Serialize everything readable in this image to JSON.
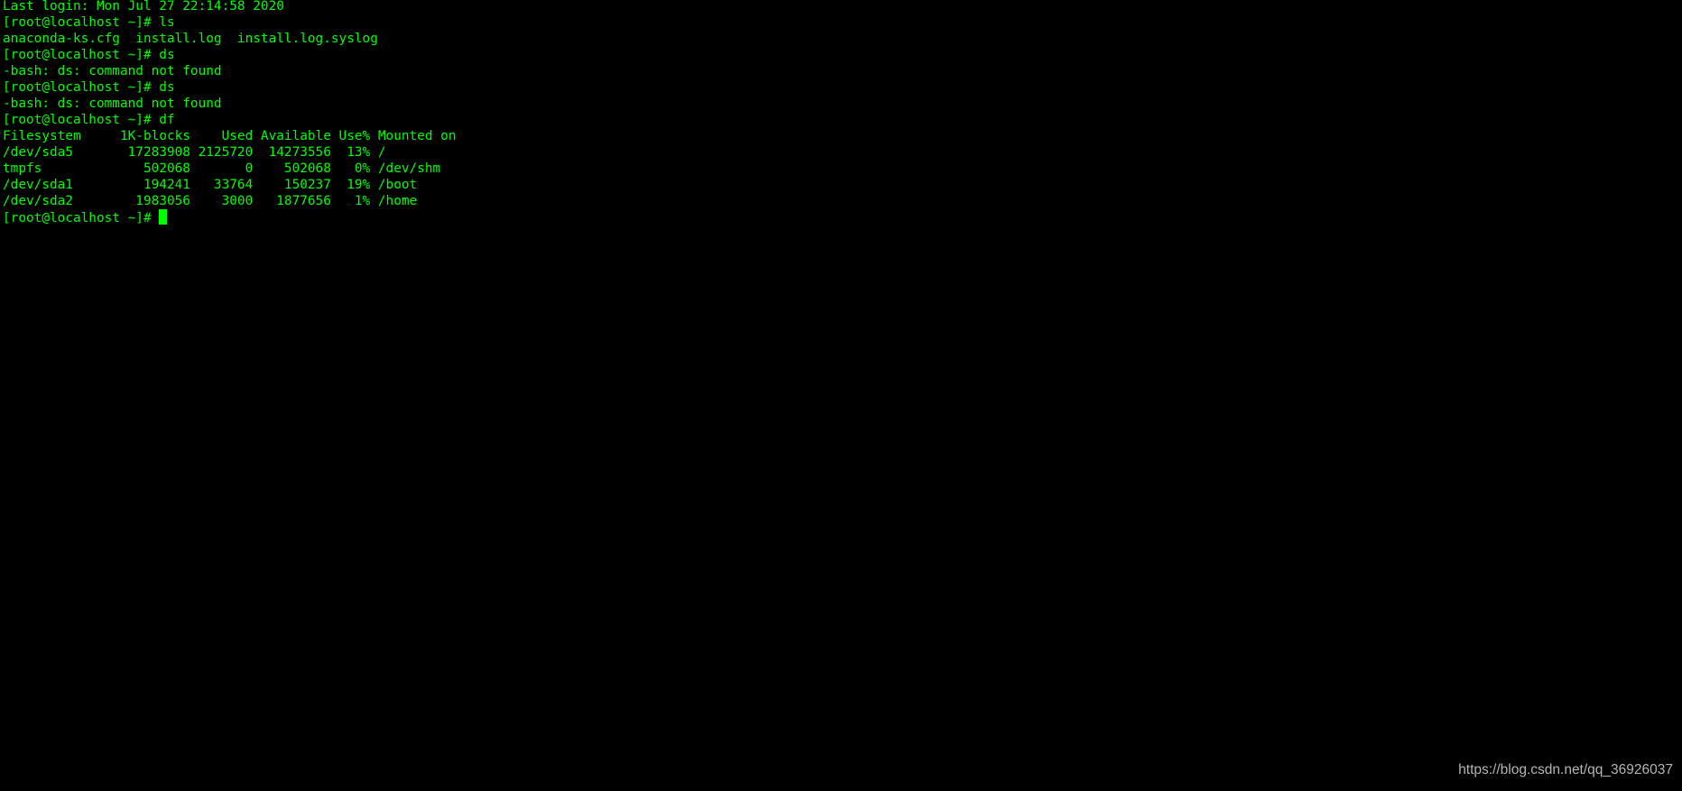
{
  "terminal": {
    "lines": [
      "Last login: Mon Jul 27 22:14:58 2020",
      "[root@localhost ~]# ls",
      "anaconda-ks.cfg  install.log  install.log.syslog",
      "[root@localhost ~]# ds",
      "-bash: ds: command not found",
      "[root@localhost ~]# ds",
      "-bash: ds: command not found",
      "[root@localhost ~]# df",
      "Filesystem     1K-blocks    Used Available Use% Mounted on",
      "/dev/sda5       17283908 2125720  14273556  13% /",
      "tmpfs             502068       0    502068   0% /dev/shm",
      "/dev/sda1         194241   33764    150237  19% /boot",
      "/dev/sda2        1983056    3000   1877656   1% /home"
    ],
    "prompt": "[root@localhost ~]# ",
    "text_color": "#00ff00",
    "background": "#000000"
  },
  "watermark": "https://blog.csdn.net/qq_36926037"
}
